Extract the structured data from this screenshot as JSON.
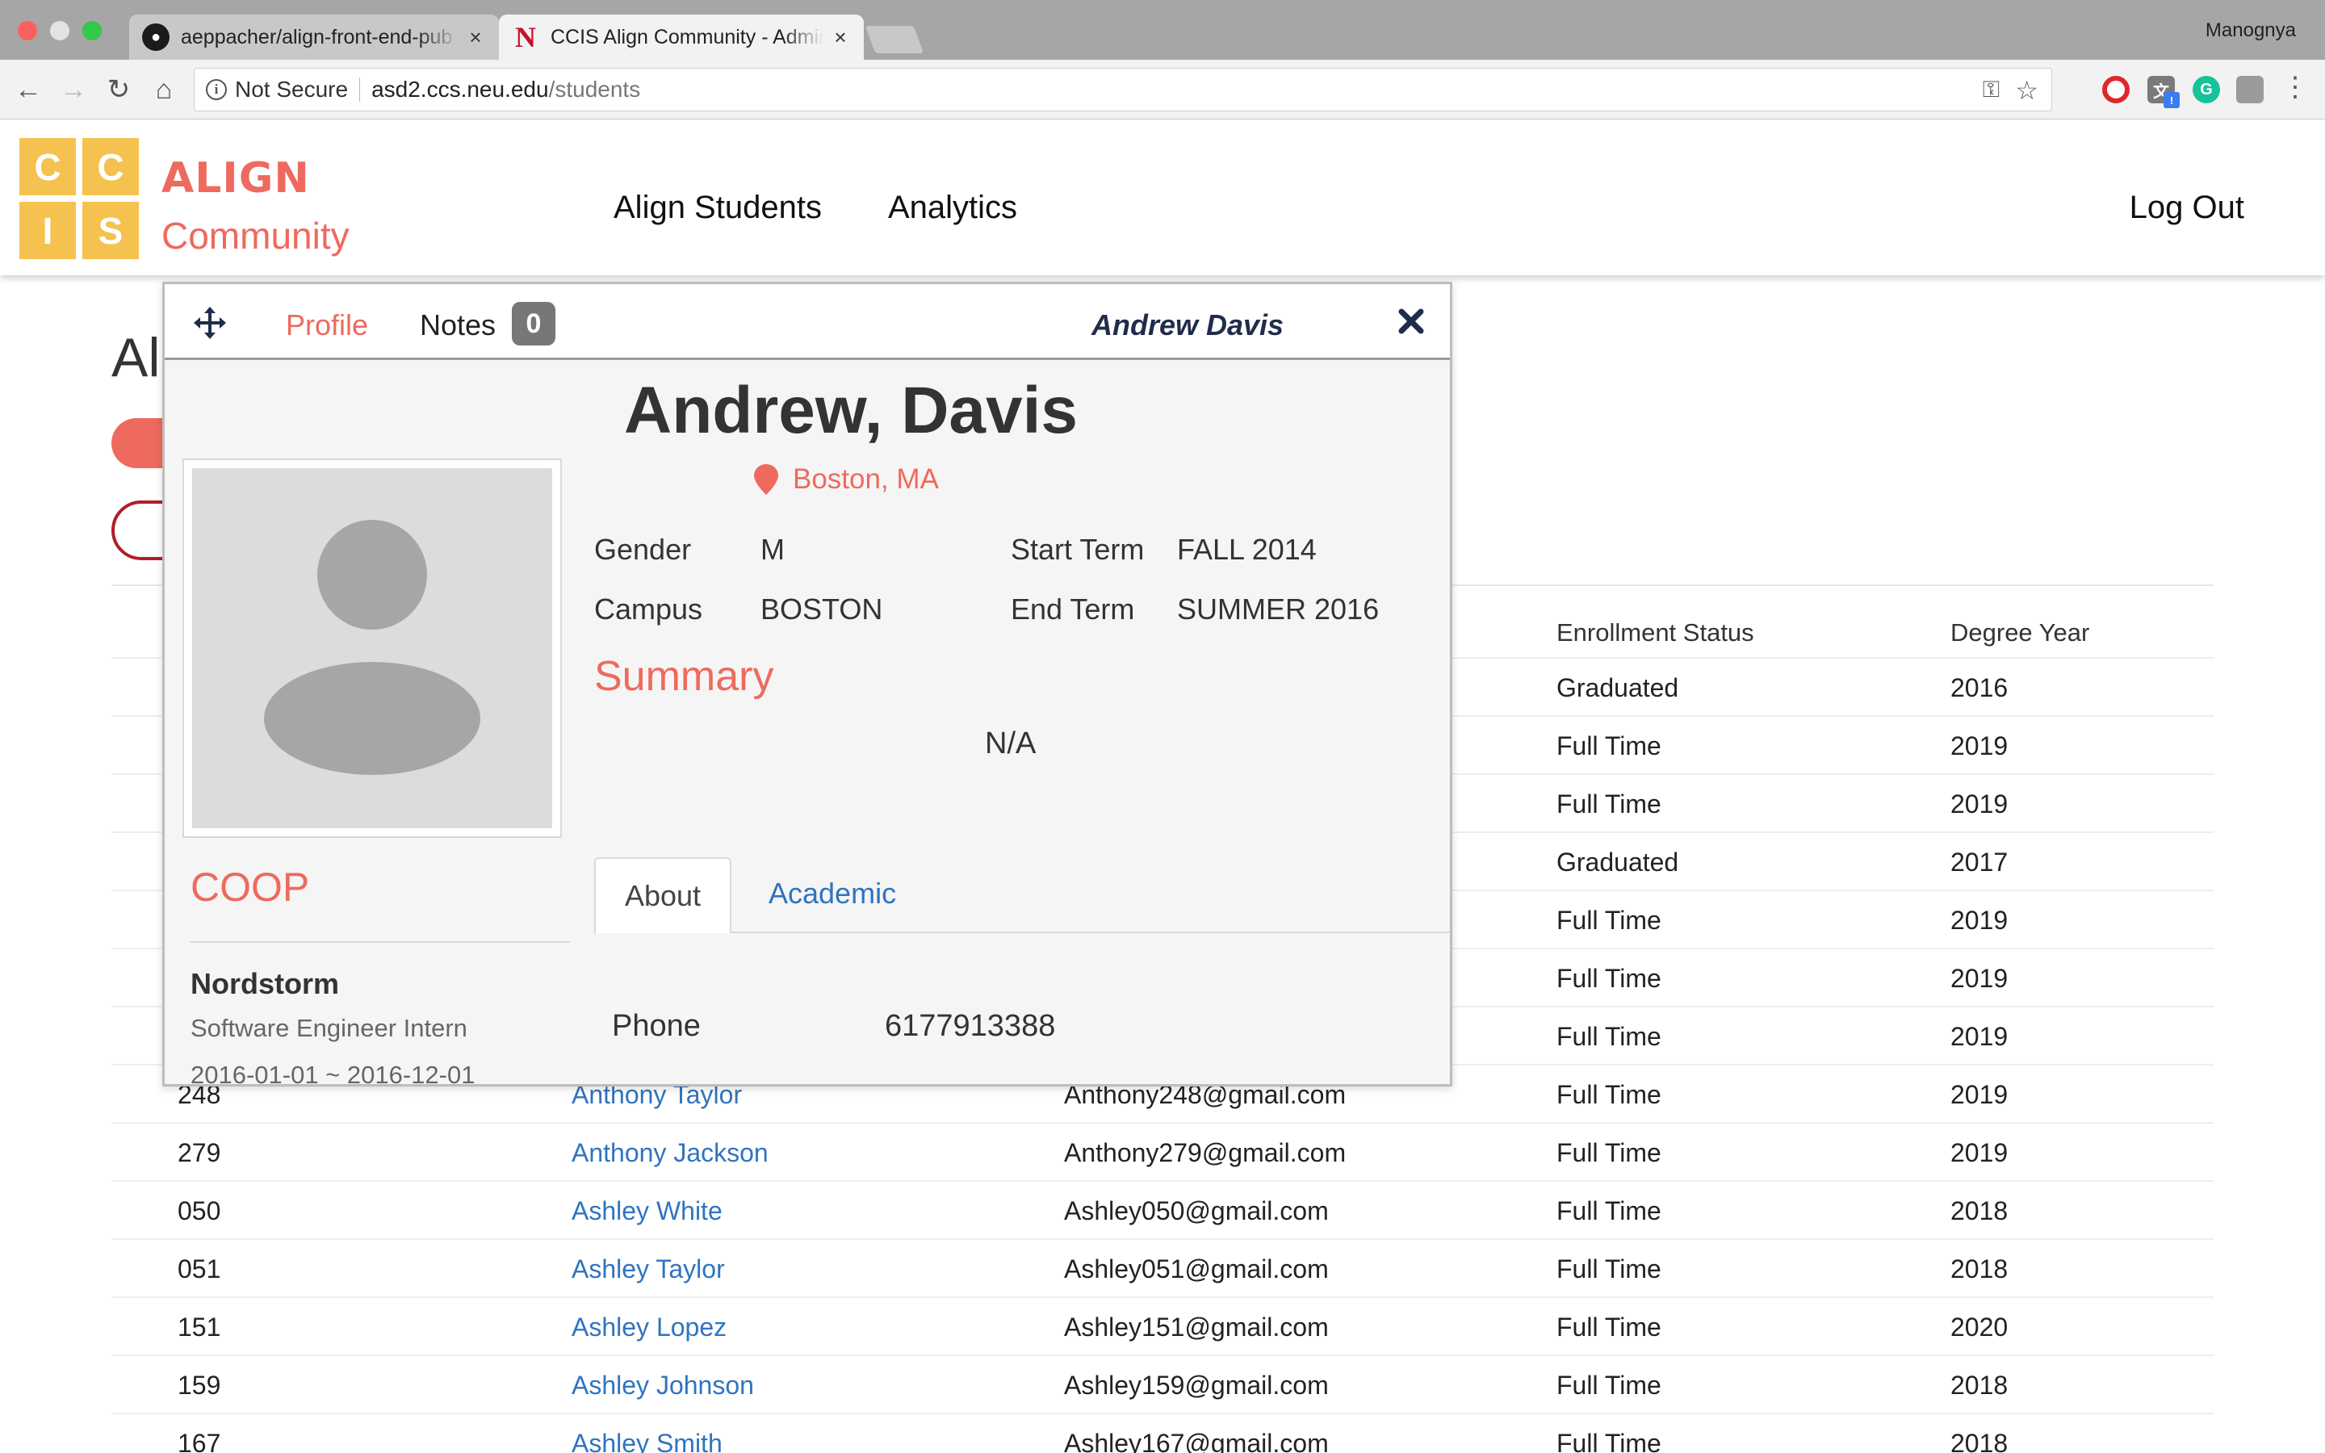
{
  "browser": {
    "tabs": [
      {
        "title": "aeppacher/align-front-end-pub",
        "close": "×"
      },
      {
        "title": "CCIS Align Community - Admin",
        "close": "×"
      }
    ],
    "profile_name": "Manognya",
    "address": {
      "security": "Not Secure",
      "host": "asd2.ccs.neu.edu",
      "path": "/students"
    }
  },
  "header": {
    "logo_letters": [
      "C",
      "C",
      "I",
      "S"
    ],
    "brand_title": "ALIGN",
    "brand_subtitle": "Community",
    "nav": {
      "students": "Align Students",
      "analytics": "Analytics",
      "logout": "Log Out"
    }
  },
  "page": {
    "heading_partial": "Al",
    "columns": {
      "status": "Enrollment Status",
      "year": "Degree Year"
    },
    "rows_partial": [
      {
        "status": "Graduated",
        "year": "2016"
      },
      {
        "status": "Full Time",
        "year": "2019"
      },
      {
        "status": "Full Time",
        "year": "2019"
      },
      {
        "status": "Graduated",
        "year": "2017"
      },
      {
        "status": "Full Time",
        "year": "2019"
      },
      {
        "status": "Full Time",
        "year": "2019"
      },
      {
        "status": "Full Time",
        "year": "2019"
      }
    ],
    "rows": [
      {
        "id": "248",
        "name": "Anthony Taylor",
        "email": "Anthony248@gmail.com",
        "status": "Full Time",
        "year": "2019"
      },
      {
        "id": "279",
        "name": "Anthony Jackson",
        "email": "Anthony279@gmail.com",
        "status": "Full Time",
        "year": "2019"
      },
      {
        "id": "050",
        "name": "Ashley White",
        "email": "Ashley050@gmail.com",
        "status": "Full Time",
        "year": "2018"
      },
      {
        "id": "051",
        "name": "Ashley Taylor",
        "email": "Ashley051@gmail.com",
        "status": "Full Time",
        "year": "2018"
      },
      {
        "id": "151",
        "name": "Ashley Lopez",
        "email": "Ashley151@gmail.com",
        "status": "Full Time",
        "year": "2020"
      },
      {
        "id": "159",
        "name": "Ashley Johnson",
        "email": "Ashley159@gmail.com",
        "status": "Full Time",
        "year": "2018"
      },
      {
        "id": "167",
        "name": "Ashley Smith",
        "email": "Ashley167@gmail.com",
        "status": "Full Time",
        "year": "2018"
      }
    ]
  },
  "modal": {
    "tab_profile": "Profile",
    "tab_notes": "Notes",
    "notes_count": "0",
    "header_name": "Andrew Davis",
    "full_name": "Andrew, Davis",
    "location": "Boston, MA",
    "info": {
      "gender_label": "Gender",
      "gender": "M",
      "campus_label": "Campus",
      "campus": "BOSTON",
      "start_label": "Start Term",
      "start": "FALL 2014",
      "end_label": "End Term",
      "end": "SUMMER 2016"
    },
    "summary_title": "Summary",
    "summary_text": "N/A",
    "subtabs": {
      "about": "About",
      "academic": "Academic"
    },
    "phone_label": "Phone",
    "phone": "6177913388",
    "coop": {
      "title": "COOP",
      "company": "Nordstorm",
      "role": "Software Engineer Intern",
      "dates": "2016-01-01 ~ 2016-12-01"
    }
  },
  "colors": {
    "accent": "#ee6a5e",
    "link": "#2f74c0",
    "logo": "#f5c24f",
    "dark_red": "#b11d2a"
  },
  "icons": [
    "github-icon",
    "northeastern-icon",
    "back-icon",
    "forward-icon",
    "reload-icon",
    "home-icon",
    "info-icon",
    "key-icon",
    "star-icon",
    "move-icon",
    "close-icon",
    "location-pin-icon",
    "avatar-icon"
  ]
}
